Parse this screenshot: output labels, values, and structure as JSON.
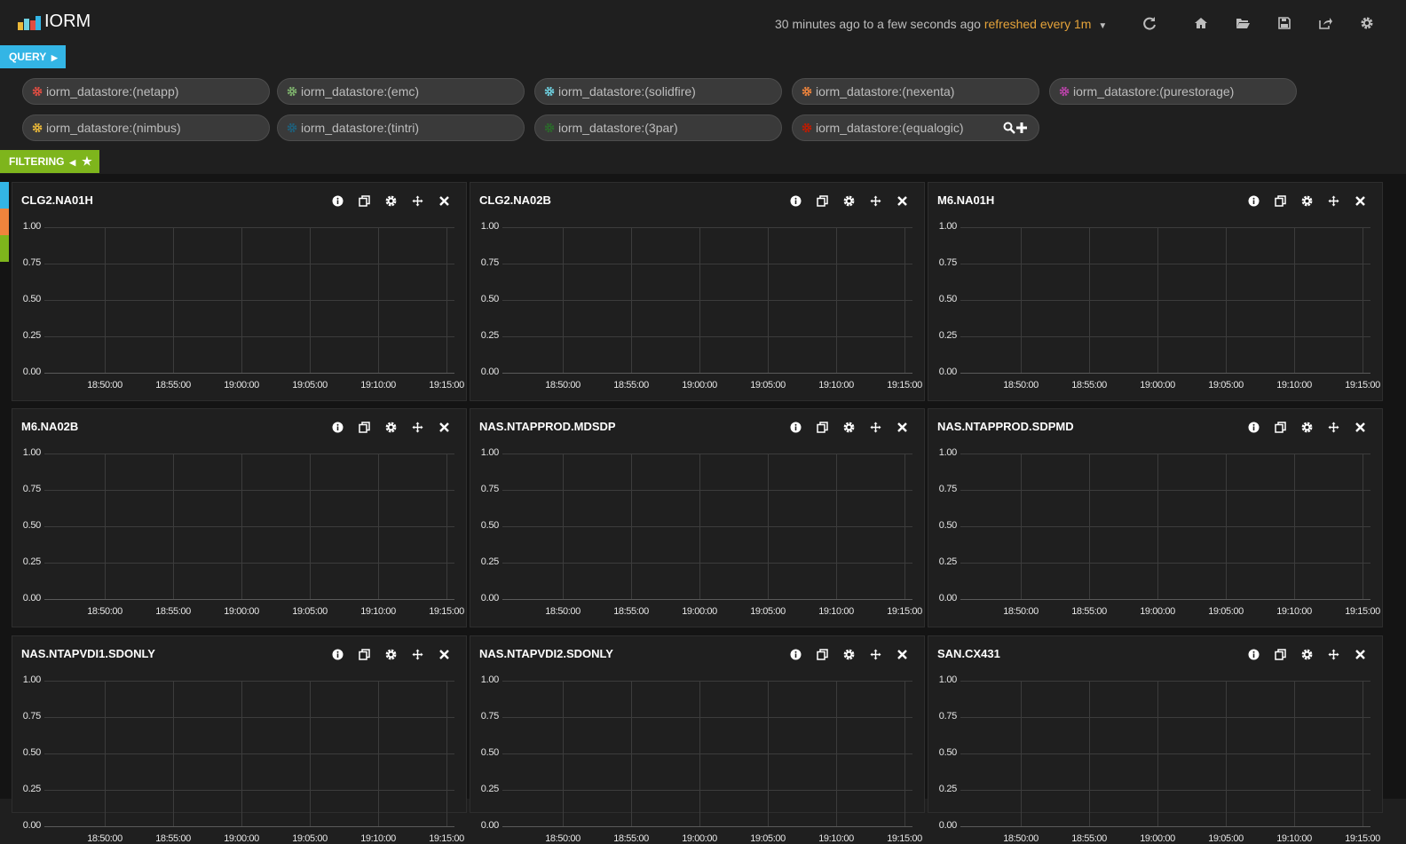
{
  "app": {
    "title": "IORM"
  },
  "timepicker": {
    "range": "30 minutes ago to a few seconds ago",
    "refresh": "refreshed every 1m"
  },
  "toolbar_icons": [
    "refresh-icon",
    "home-icon",
    "folder-open-icon",
    "save-icon",
    "share-icon",
    "gear-icon"
  ],
  "query": {
    "tab_label": "QUERY",
    "pills": [
      {
        "label": "iorm_datastore:(netapp)",
        "color": "#e24d42"
      },
      {
        "label": "iorm_datastore:(emc)",
        "color": "#7eb26d"
      },
      {
        "label": "iorm_datastore:(solidfire)",
        "color": "#6ed0e0"
      },
      {
        "label": "iorm_datastore:(nexenta)",
        "color": "#ef843c"
      },
      {
        "label": "iorm_datastore:(purestorage)",
        "color": "#ba43a9"
      },
      {
        "label": "iorm_datastore:(nimbus)",
        "color": "#eab839"
      },
      {
        "label": "iorm_datastore:(tintri)",
        "color": "#1f5f7a"
      },
      {
        "label": "iorm_datastore:(3par)",
        "color": "#2b6b2b"
      },
      {
        "label": "iorm_datastore:(equalogic)",
        "color": "#bf1b00"
      }
    ]
  },
  "filtering": {
    "tab_label": "FILTERING"
  },
  "row_colors": [
    "#33b5e5",
    "#ef843c",
    "#7eb51c"
  ],
  "y_ticks": [
    "1.00",
    "0.75",
    "0.50",
    "0.25",
    "0.00"
  ],
  "x_ticks": [
    "18:50:00",
    "18:55:00",
    "19:00:00",
    "19:05:00",
    "19:10:00",
    "19:15:00"
  ],
  "panels": [
    {
      "title": "CLG2.NA01H"
    },
    {
      "title": "CLG2.NA02B"
    },
    {
      "title": "M6.NA01H"
    },
    {
      "title": "M6.NA02B"
    },
    {
      "title": "NAS.NTAPPROD.MDSDP"
    },
    {
      "title": "NAS.NTAPPROD.SDPMD"
    },
    {
      "title": "NAS.NTAPVDI1.SDONLY"
    },
    {
      "title": "NAS.NTAPVDI2.SDONLY"
    },
    {
      "title": "SAN.CX431"
    }
  ]
}
